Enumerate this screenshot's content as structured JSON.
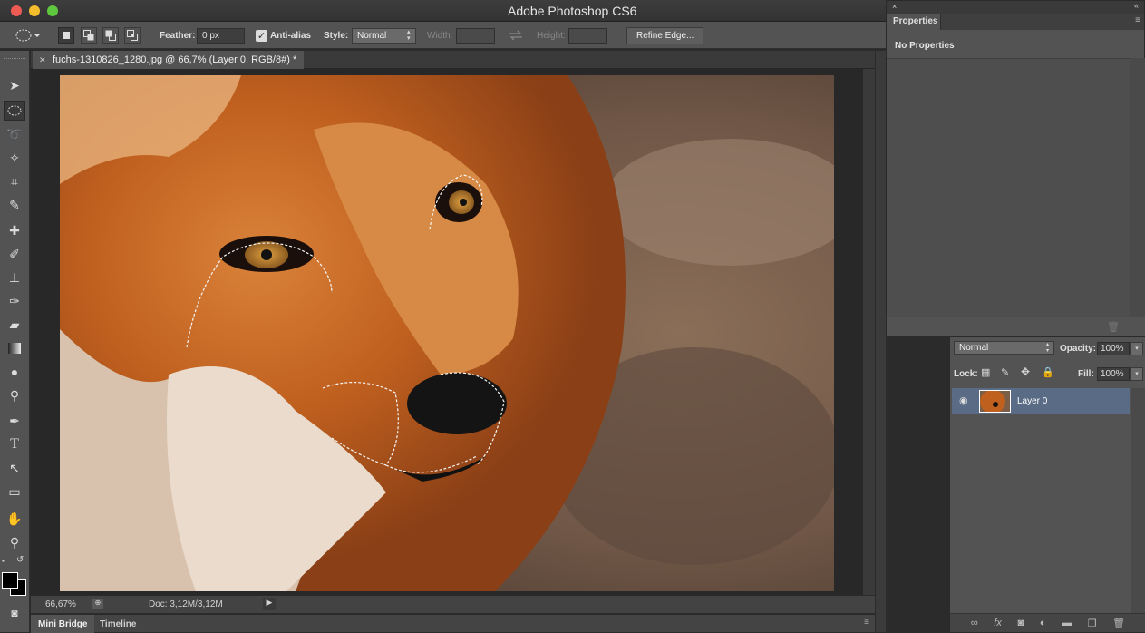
{
  "app": {
    "title": "Adobe Photoshop CS6"
  },
  "options": {
    "feather_label": "Feather:",
    "feather_value": "0 px",
    "antialias_label": "Anti-alias",
    "style_label": "Style:",
    "style_value": "Normal",
    "width_label": "Width:",
    "height_label": "Height:",
    "refine_label": "Refine Edge..."
  },
  "document": {
    "tab_title": "fuchs-1310826_1280.jpg @ 66,7% (Layer 0, RGB/8#) *",
    "close_glyph": "✕"
  },
  "status": {
    "zoom": "66,67%",
    "doc_info": "Doc: 3,12M/3,12M"
  },
  "bottom_tabs": {
    "mini_bridge": "Mini Bridge",
    "timeline": "Timeline"
  },
  "properties": {
    "tab_label": "Properties",
    "empty_text": "No Properties"
  },
  "layers": {
    "blend_mode": "Normal",
    "opacity_label": "Opacity:",
    "opacity_value": "100%",
    "lock_label": "Lock:",
    "fill_label": "Fill:",
    "fill_value": "100%",
    "items": [
      {
        "name": "Layer 0",
        "visible": true,
        "selected": true
      }
    ]
  },
  "colors": {
    "accent": "#5a6b85",
    "panel": "#535353",
    "canvas_bg": "#282828"
  }
}
